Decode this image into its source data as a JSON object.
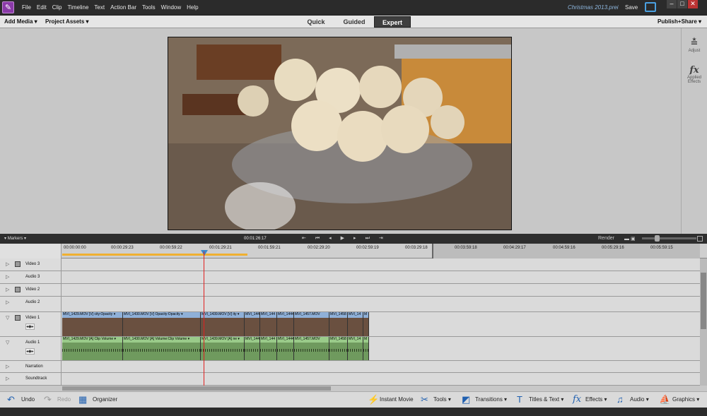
{
  "app": {
    "logo_glyph": "✎",
    "project_name": "Christmas 2013.prei",
    "save_label": "Save"
  },
  "menu": [
    "File",
    "Edit",
    "Clip",
    "Timeline",
    "Text",
    "Action Bar",
    "Tools",
    "Window",
    "Help"
  ],
  "toolbar": {
    "add_media": "Add Media ▾",
    "project_assets": "Project Assets ▾",
    "publish": "Publish+Share ▾"
  },
  "modes": {
    "quick": "Quick",
    "guided": "Guided",
    "expert": "Expert"
  },
  "right_panel": {
    "adjust_label": "Adjust",
    "adjust_icon": "≛",
    "effects_icon": "fx",
    "effects_label1": "Applied",
    "effects_label2": "Effects"
  },
  "timeline_header": {
    "markers": "Markers",
    "timecode": "00:01:26:17",
    "render": "Render"
  },
  "ruler": [
    "00:00:00:00",
    "00:00:29:23",
    "00:00:59:22",
    "00:01:29:21",
    "00:01:59:21",
    "00:02:29:20",
    "00:02:59:19",
    "00:03:29:18",
    "00:03:59:18",
    "00:04:29:17",
    "00:04:59:16",
    "00:05:29:16",
    "00:05:59:15"
  ],
  "tracks": [
    {
      "name": "Video 3",
      "type": "video"
    },
    {
      "name": "Audio 3",
      "type": "audio"
    },
    {
      "name": "Video 2",
      "type": "video"
    },
    {
      "name": "Audio 2",
      "type": "audio"
    },
    {
      "name": "Video 1",
      "type": "video"
    },
    {
      "name": "Audio 1",
      "type": "audio"
    },
    {
      "name": "Narration",
      "type": "narration"
    },
    {
      "name": "Soundtrack",
      "type": "soundtrack"
    }
  ],
  "video_clips": [
    "MVI_1429.MOV [V] city:Opacity ▾",
    "MVI_1430.MOV [V] Opacity:Opacity ▾",
    "MVI_1439.MOV [V] ity ▾",
    "MVI_1440",
    "MVI_144",
    "MVI_1444",
    "MVI_1457.MOV",
    "MVI_1458",
    "MVI_14",
    "M"
  ],
  "audio_clips": [
    "MVI_1429.MOV [A] Clip Volume ▾",
    "MVI_1430.MOV [A] Volume:Clip Volume ▾",
    "MVI_1439.MOV [A] ne ▾",
    "MVI_1440",
    "MVI_144",
    "MVI_1444",
    "MVI_1457.MOV",
    "MVI_1458",
    "MVI_14",
    "M"
  ],
  "bottom": {
    "undo": "Undo",
    "redo": "Redo",
    "organizer": "Organizer",
    "instant_movie": "Instant Movie",
    "tools": "Tools",
    "transitions": "Transitions",
    "titles": "Titles & Text",
    "effects": "Effects",
    "audio": "Audio",
    "graphics": "Graphics"
  }
}
